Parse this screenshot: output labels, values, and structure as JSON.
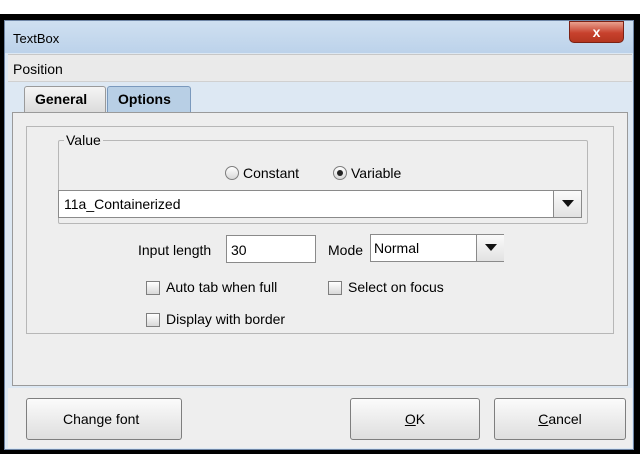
{
  "window": {
    "title": "TextBox",
    "close_symbol": "x"
  },
  "menu": {
    "items": [
      "Position"
    ]
  },
  "tabs": [
    {
      "label": "General",
      "selected": false
    },
    {
      "label": "Options",
      "selected": true
    }
  ],
  "value_group": {
    "legend": "Value",
    "constant_label": "Constant",
    "variable_label": "Variable",
    "selected": "Variable",
    "combo_value": "11a_Containerized"
  },
  "input_length": {
    "label": "Input length",
    "value": "30"
  },
  "mode": {
    "label": "Mode",
    "value": "Normal"
  },
  "checkboxes": {
    "auto_tab": {
      "label": "Auto tab when full",
      "checked": false
    },
    "select_on_focus": {
      "label": "Select on focus",
      "checked": false
    },
    "display_border": {
      "label": "Display with border",
      "checked": false
    }
  },
  "buttons": {
    "change_font": "Change font",
    "ok_mnemonic": "O",
    "ok_rest": "K",
    "cancel_mnemonic": "C",
    "cancel_rest": "ancel"
  }
}
